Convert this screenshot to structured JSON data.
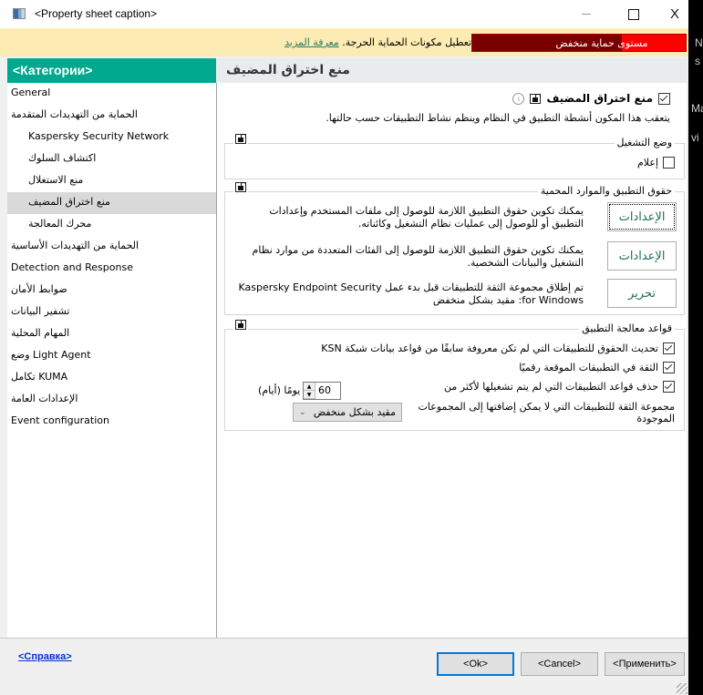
{
  "window": {
    "title": "<Property sheet caption>",
    "minimize_icon": "minimize-icon",
    "maximize_icon": "maximize-icon",
    "close_label": "X"
  },
  "alert": {
    "message": "تم تعطيل مكونات الحماية الحرجة.",
    "link": "معرفة المزيد",
    "level_label": "مستوى حماية منخفض",
    "level_fill_percent": 30,
    "colors": {
      "bar_bg": "#fcebb2",
      "level_dark": "#7a0000",
      "level_fill": "#ff0000"
    }
  },
  "sidebar": {
    "header": "<Категории>",
    "header_color": "#00a88e",
    "items": [
      {
        "label": "General",
        "level": 0,
        "selected": false
      },
      {
        "label": "الحماية من التهديدات المتقدمة",
        "level": 0,
        "selected": false
      },
      {
        "label": "Kaspersky Security Network",
        "level": 1,
        "selected": false
      },
      {
        "label": "اكتشاف السلوك",
        "level": 1,
        "selected": false
      },
      {
        "label": "منع الاستغلال",
        "level": 1,
        "selected": false
      },
      {
        "label": "منع اختراق المضيف",
        "level": 1,
        "selected": true
      },
      {
        "label": "محرك المعالجة",
        "level": 1,
        "selected": false
      },
      {
        "label": "الحماية من التهديدات الأساسية",
        "level": 0,
        "selected": false
      },
      {
        "label": "Detection and Response",
        "level": 0,
        "selected": false
      },
      {
        "label": "ضوابط الأمان",
        "level": 0,
        "selected": false
      },
      {
        "label": "تشفير البيانات",
        "level": 0,
        "selected": false
      },
      {
        "label": "المهام المحلية",
        "level": 0,
        "selected": false
      },
      {
        "label": "وضع Light Agent",
        "level": 0,
        "selected": false
      },
      {
        "label": "تكامل KUMA",
        "level": 0,
        "selected": false
      },
      {
        "label": "الإعدادات العامة",
        "level": 0,
        "selected": false
      },
      {
        "label": "Event configuration",
        "level": 0,
        "selected": false
      }
    ]
  },
  "content": {
    "header": "منع اختراق المضيف",
    "main_toggle": {
      "label": "منع اختراق المضيف",
      "checked": true
    },
    "description": "يتعقب هذا المكون أنشطة التطبيق في النظام وينظم نشاط التطبيقات حسب حالتها.",
    "operation_mode": {
      "title": "وضع التشغيل",
      "notify": {
        "label": "إعلام",
        "checked": false
      }
    },
    "rights": {
      "title": "حقوق التطبيق والموارد المحمية",
      "rows": [
        {
          "button": "الإعدادات",
          "text": "يمكنك تكوين حقوق التطبيق اللازمة للوصول إلى ملفات المستخدم وإعدادات التطبيق أو للوصول إلى عمليات نظام التشغيل وكائناته."
        },
        {
          "button": "الإعدادات",
          "text": "يمكنك تكوين حقوق التطبيق اللازمة للوصول إلى الفئات المتعددة من موارد نظام التشغيل والبيانات الشخصية."
        },
        {
          "button": "تحرير",
          "text": "تم إطلاق مجموعة الثقة للتطبيقات قبل بدء عمل Kaspersky Endpoint Security for Windows: مقيد بشكل منخفض"
        }
      ]
    },
    "rules": {
      "title": "قواعد معالجة التطبيق",
      "options": [
        {
          "label": "تحديث الحقوق للتطبيقات التي لم تكن معروفة سابقًا من قواعد بيانات شبكة KSN",
          "checked": true
        },
        {
          "label": "الثقة في التطبيقات الموقعة رقميًا",
          "checked": true
        },
        {
          "label": "حذف قواعد التطبيقات التي لم يتم تشغيلها لأكثر من",
          "checked": true
        }
      ],
      "days_value": "60",
      "days_unit": "يومًا (أيام)",
      "trust_group_label": "مجموعة الثقة للتطبيقات التي لا يمكن إضافتها إلى المجموعات الموجودة",
      "trust_group_value": "مقيد بشكل منخفض"
    }
  },
  "footer": {
    "help": "<Справка>",
    "ok": "<Ok>",
    "cancel": "<Cancel>",
    "apply": "<Применить>"
  },
  "background_fragments": [
    "N",
    "s",
    "Ma",
    "vi"
  ]
}
